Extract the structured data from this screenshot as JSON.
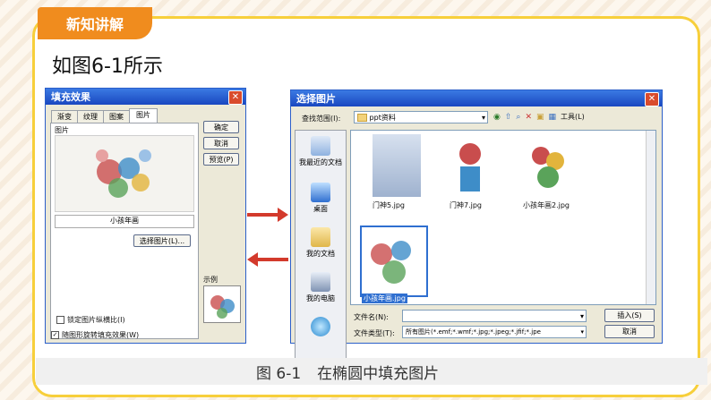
{
  "slide": {
    "tag": "新知讲解",
    "heading": "如图6-1所示",
    "caption_num": "图 6-1",
    "caption_text": "在椭圆中填充图片"
  },
  "fill_dialog": {
    "title": "填充效果",
    "close": "✕",
    "tabs": [
      "渐变",
      "纹理",
      "图案",
      "图片"
    ],
    "active_tab": "图片",
    "section_label": "图片",
    "image_name": "小孩年画",
    "select_button": "选择图片(L)...",
    "buttons": {
      "ok": "确定",
      "cancel": "取消",
      "preview": "预览(P)"
    },
    "sample_label": "示例",
    "check_lock": "锁定图片纵横比(I)",
    "check_rotate": "随图形旋转填充效果(W)"
  },
  "file_dialog": {
    "title": "选择图片",
    "close": "✕",
    "lookin_label": "查找范围(I):",
    "lookin_value": "ppt资料",
    "tools_label": "工具(L)",
    "places": [
      "我最近的文档",
      "桌面",
      "我的文档",
      "我的电脑",
      ""
    ],
    "files": [
      {
        "name": "门神5.jpg"
      },
      {
        "name": "门神7.jpg"
      },
      {
        "name": "小孩年画2.jpg"
      },
      {
        "name": "小孩年画.jpg",
        "selected": true
      }
    ],
    "filename_label": "文件名(N):",
    "filetype_label": "文件类型(T):",
    "filetype_value": "所有图片(*.emf;*.wmf;*.jpg;*.jpeg;*.jfif;*.jpe",
    "insert_button": "插入(S)",
    "cancel_button": "取消"
  },
  "colors": {
    "accent_orange": "#f08c1e",
    "frame_yellow": "#f7cf3b",
    "arrow_red": "#d33a2c"
  }
}
